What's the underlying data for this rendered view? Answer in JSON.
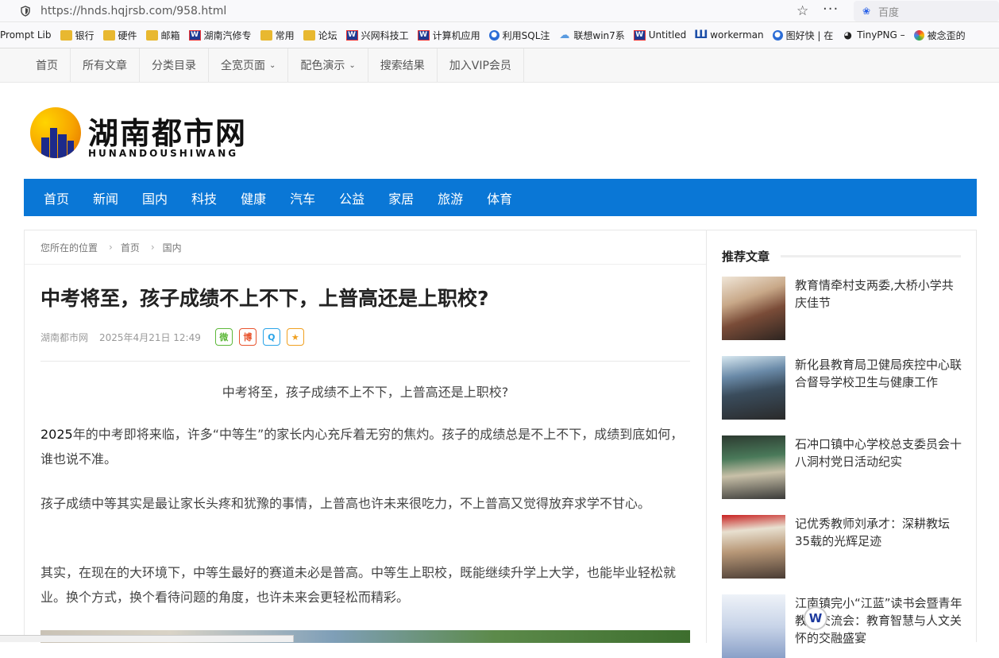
{
  "browser": {
    "url": "https://hnds.hqjrsb.com/958.html",
    "search_placeholder": "百度",
    "bookmarks": [
      {
        "label": "Prompt Lib",
        "icon": "none"
      },
      {
        "label": "银行",
        "icon": "folder-icon"
      },
      {
        "label": "硬件",
        "icon": "folder-icon"
      },
      {
        "label": "邮箱",
        "icon": "folder-icon"
      },
      {
        "label": "湖南汽修专",
        "icon": "w-icon"
      },
      {
        "label": "常用",
        "icon": "folder-icon"
      },
      {
        "label": "论坛",
        "icon": "folder-icon"
      },
      {
        "label": "兴网科技工",
        "icon": "w-icon"
      },
      {
        "label": "计算机应用",
        "icon": "w-icon"
      },
      {
        "label": "利用SQL注",
        "icon": "circle-icon"
      },
      {
        "label": "联想win7系",
        "icon": "cloud-icon"
      },
      {
        "label": "Untitled",
        "icon": "w-icon"
      },
      {
        "label": "workerman",
        "icon": "u-icon"
      },
      {
        "label": "图好快 | 在",
        "icon": "circle-icon"
      },
      {
        "label": "TinyPNG –",
        "icon": "panda-icon"
      },
      {
        "label": "被念歪的",
        "icon": "ring-icon"
      }
    ]
  },
  "site_nav": [
    {
      "label": "首页",
      "dropdown": false
    },
    {
      "label": "所有文章",
      "dropdown": false
    },
    {
      "label": "分类目录",
      "dropdown": false
    },
    {
      "label": "全宽页面",
      "dropdown": true
    },
    {
      "label": "配色演示",
      "dropdown": true
    },
    {
      "label": "搜索结果",
      "dropdown": false
    },
    {
      "label": "加入VIP会员",
      "dropdown": false
    }
  ],
  "logo": {
    "title": "湖南都市网",
    "subtitle": "HUNANDOUSHIWANG"
  },
  "main_nav": [
    "首页",
    "新闻",
    "国内",
    "科技",
    "健康",
    "汽车",
    "公益",
    "家居",
    "旅游",
    "体育"
  ],
  "breadcrumb": {
    "prefix": "您所在的位置",
    "items": [
      "首页",
      "国内"
    ]
  },
  "article": {
    "title": "中考将至，孩子成绩不上不下，上普高还是上职校?",
    "source": "湖南都市网",
    "date": "2025年4月21日 12:49",
    "lead": "中考将至，孩子成绩不上不下，上普高还是上职校?",
    "p1_strong": "2025",
    "p1_rest": "年的中考即将来临，许多“中等生”的家长内心充斥着无穷的焦灼。孩子的成绩总是不上不下，成绩到底如何，谁也说不准。",
    "p2": "孩子成绩中等其实是最让家长头疼和犹豫的事情，上普高也许未来很吃力，不上普高又觉得放弃求学不甘心。",
    "p3": "其实，在现在的大环境下，中等生最好的赛道未必是普高。中等生上职校，既能继续升学上大学，也能毕业轻松就业。换个方式，换个看待问题的角度，也许未来会更轻松而精彩。"
  },
  "share": {
    "wechat": "微",
    "weibo": "博",
    "qq": "Q",
    "favorite": "★"
  },
  "sidebar": {
    "title": "推荐文章",
    "items": [
      {
        "title": "教育情牵村支两委,大桥小学共庆佳节"
      },
      {
        "title": "新化县教育局卫健局疾控中心联合督导学校卫生与健康工作"
      },
      {
        "title": "石冲口镇中心学校总支委员会十八洞村党日活动纪实"
      },
      {
        "title": "记优秀教师刘承才：深耕教坛35载的光辉足迹"
      },
      {
        "title": "江南镇完小“江蓝”读书会暨青年教师交流会：教育智慧与人文关怀的交融盛宴"
      }
    ]
  },
  "float_logo": "W"
}
